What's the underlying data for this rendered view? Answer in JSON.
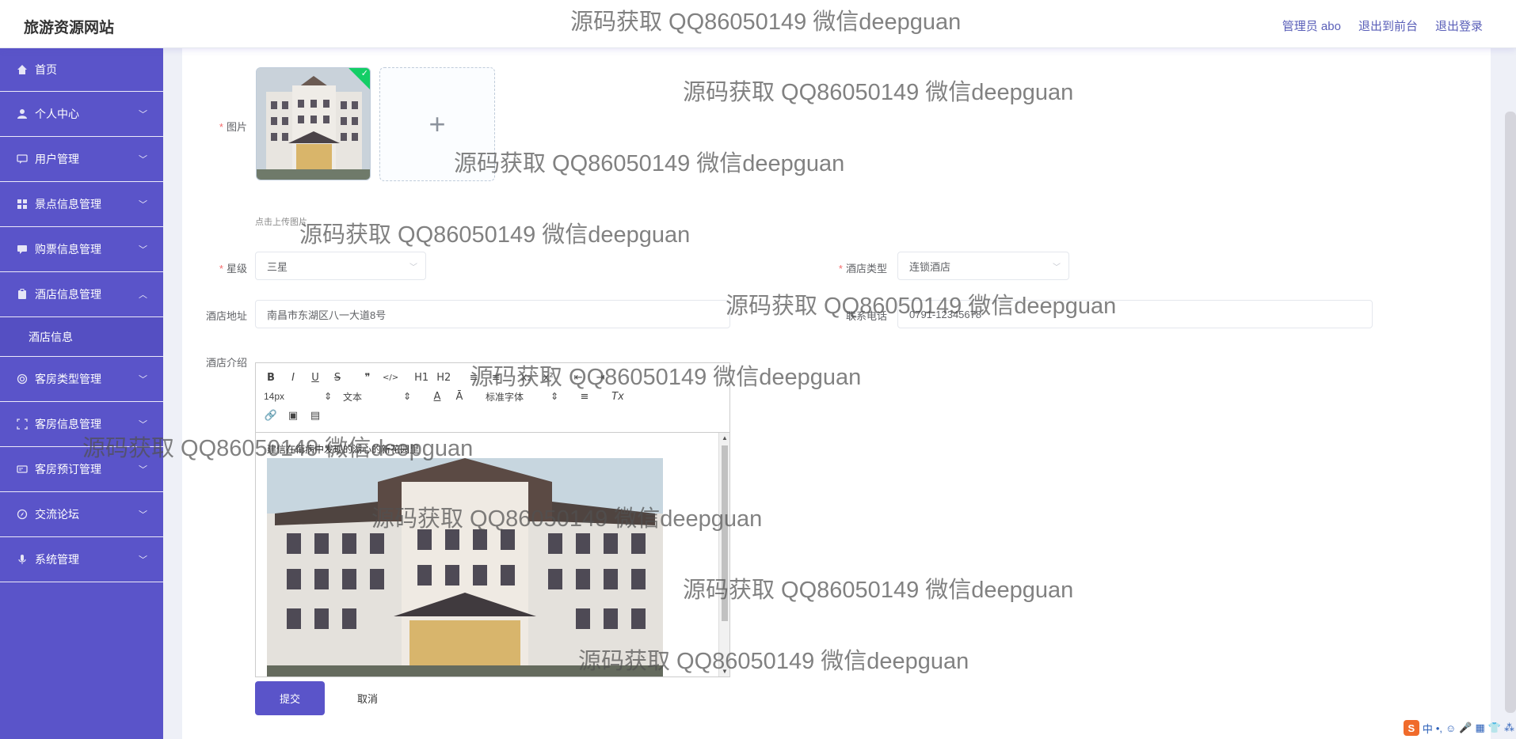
{
  "header": {
    "brand": "旅游资源网站",
    "links": [
      "管理员 abo",
      "退出到前台",
      "退出登录"
    ]
  },
  "sidebar": {
    "items": [
      {
        "label": "首页",
        "icon": "home-icon"
      },
      {
        "label": "个人中心",
        "icon": "user-icon"
      },
      {
        "label": "用户管理",
        "icon": "chat-icon"
      },
      {
        "label": "景点信息管理",
        "icon": "grid-icon"
      },
      {
        "label": "购票信息管理",
        "icon": "message-icon"
      },
      {
        "label": "酒店信息管理",
        "icon": "clipboard-icon"
      },
      {
        "label": "客房类型管理",
        "icon": "circle-icon"
      },
      {
        "label": "客房信息管理",
        "icon": "frame-icon"
      },
      {
        "label": "客房预订管理",
        "icon": "card-icon"
      },
      {
        "label": "交流论坛",
        "icon": "compass-icon"
      },
      {
        "label": "系统管理",
        "icon": "mic-icon"
      }
    ],
    "submenu_label": "酒店信息"
  },
  "form": {
    "image_label": "图片",
    "upload_plus": "+",
    "upload_hint": "点击上传图片",
    "star_label": "星级",
    "star_value": "三星",
    "hotel_type_label": "酒店类型",
    "hotel_type_value": "连锁酒店",
    "address_label": "酒店地址",
    "address_value": "南昌市东湖区八一大道8号",
    "phone_label": "联系电话",
    "phone_value": "0791-12345678",
    "intro_label": "酒店介绍",
    "submit": "提交",
    "cancel": "取消"
  },
  "editor": {
    "toolbar_row1": [
      "B",
      "I",
      "U",
      "S",
      "❞",
      "</>",
      "H1",
      "H2",
      "≡",
      "≡",
      "x₂",
      "x²",
      "⇤",
      "⇥"
    ],
    "font_size": "14px",
    "block_format": "文本",
    "font_family": "标准字体",
    "toolbar_row2_tail": [
      "A",
      "Ā",
      "≡",
      "Tx"
    ],
    "toolbar_row3": [
      "🔗",
      "▣",
      "▤"
    ],
    "content_text": "建信在衔病中发现的湖心的新花园里"
  },
  "watermark": "源码获取 QQ86050149 微信deepguan",
  "ime": {
    "logo": "S",
    "items": [
      "中",
      "•,",
      "☺",
      "🎤",
      "▦",
      "👕",
      "⁂"
    ]
  },
  "colors": {
    "sidebar_bg": "#5a54c9",
    "primary": "#5a54c9",
    "required": "#f56c6c"
  }
}
